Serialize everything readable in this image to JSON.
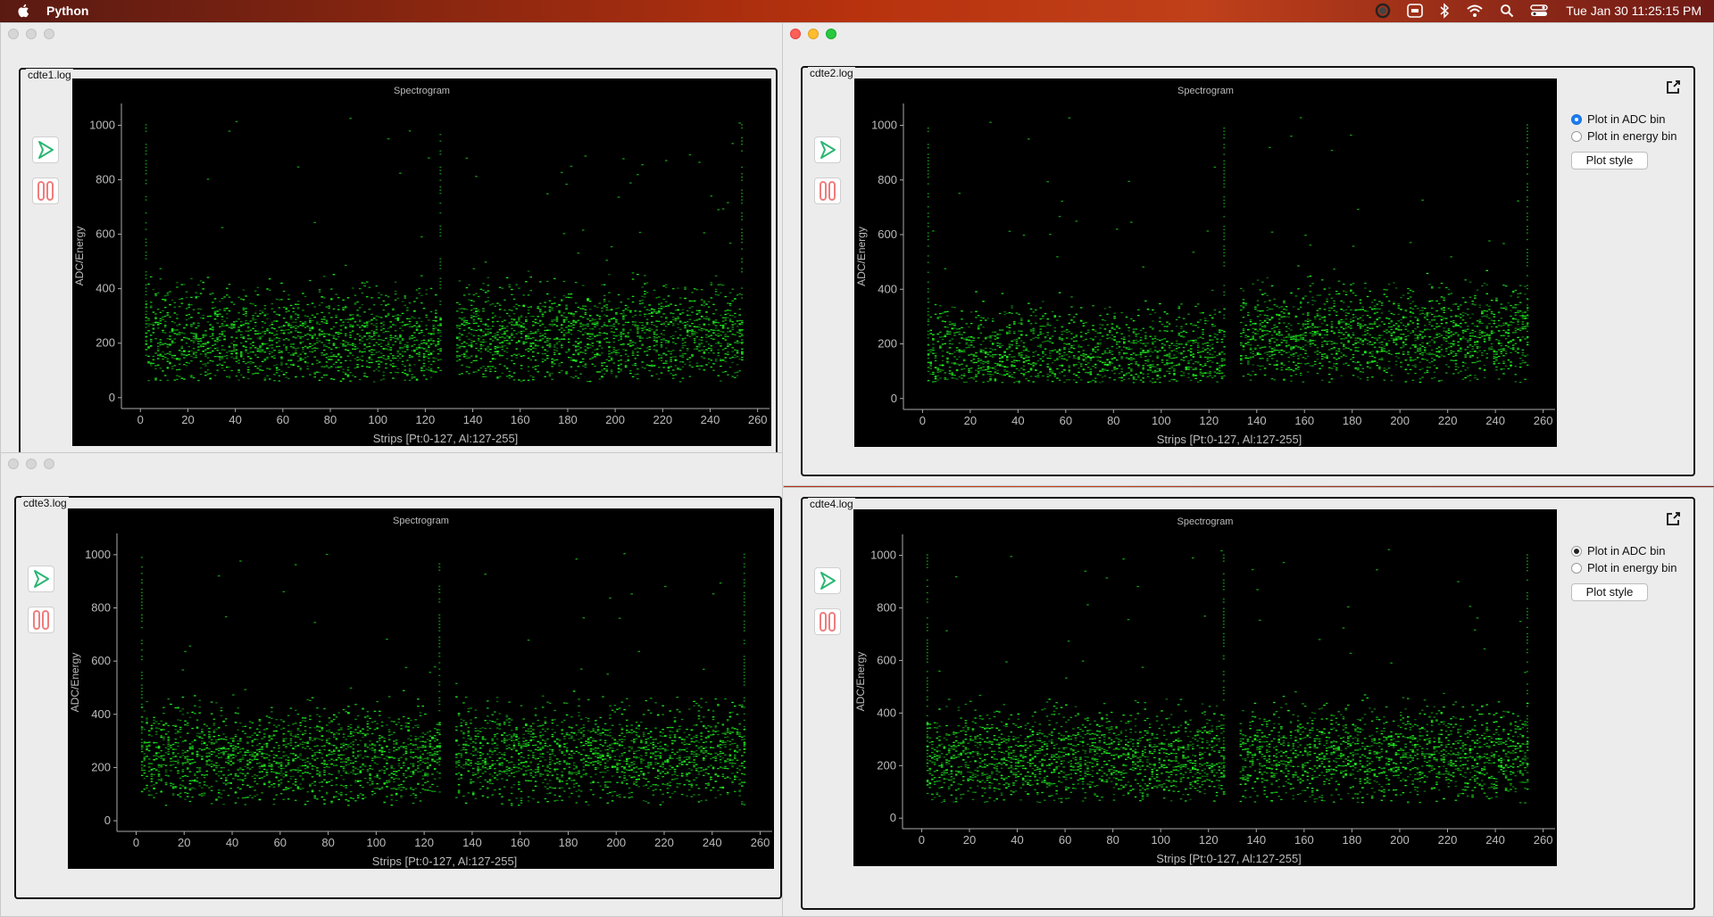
{
  "menubar": {
    "app_name": "Python",
    "clock": "Tue Jan 30  11:25:15 PM",
    "icons": [
      "apple-logo",
      "record-icon",
      "screen-share-icon",
      "bluetooth-icon",
      "wifi-icon",
      "search-icon",
      "control-center-icon"
    ]
  },
  "colors": {
    "accent": "#1a7cf5",
    "spectrum": "#22ff22",
    "plot_bg": "#000000",
    "play": "#2bb673",
    "pause": "#ef7d7d"
  },
  "windows": [
    {
      "group_label": "cdte1.log",
      "plot_title": "Spectrogram",
      "xlabel": "Strips [Pt:0-127, Al:127-255]",
      "ylabel": "ADC/Energy"
    },
    {
      "group_label": "cdte2.log",
      "plot_title": "Spectrogram",
      "xlabel": "Strips [Pt:0-127, Al:127-255]",
      "ylabel": "ADC/Energy",
      "options": {
        "adc_label": "Plot in ADC bin",
        "energy_label": "Plot in energy bin",
        "selected": "Plot in ADC bin",
        "style_button": "Plot style"
      }
    },
    {
      "group_label": "cdte3.log",
      "plot_title": "Spectrogram",
      "xlabel": "Strips [Pt:0-127, Al:127-255]",
      "ylabel": "ADC/Energy"
    },
    {
      "group_label": "cdte4.log",
      "plot_title": "Spectrogram",
      "xlabel": "Strips [Pt:0-127, Al:127-255]",
      "ylabel": "ADC/Energy",
      "options": {
        "adc_label": "Plot in ADC bin",
        "energy_label": "Plot in energy bin",
        "selected": "Plot in ADC bin",
        "style_button": "Plot style"
      }
    }
  ],
  "chart_data": [
    {
      "type": "heatmap",
      "title": "Spectrogram",
      "xlabel": "Strips [Pt:0-127, Al:127-255]",
      "ylabel": "ADC/Energy",
      "xticks": [
        0,
        20,
        40,
        60,
        80,
        100,
        120,
        140,
        160,
        180,
        200,
        220,
        240,
        260
      ],
      "yticks": [
        0,
        200,
        400,
        600,
        800,
        1000
      ],
      "xlim": [
        -8,
        265
      ],
      "ylim": [
        -40,
        1080
      ],
      "band_center": [
        210,
        230
      ],
      "gap_x": [
        127,
        132
      ]
    },
    {
      "type": "heatmap",
      "title": "Spectrogram",
      "xlabel": "Strips [Pt:0-127, Al:127-255]",
      "ylabel": "ADC/Energy",
      "xticks": [
        0,
        20,
        40,
        60,
        80,
        100,
        120,
        140,
        160,
        180,
        200,
        220,
        240,
        260
      ],
      "yticks": [
        0,
        200,
        400,
        600,
        800,
        1000
      ],
      "xlim": [
        -8,
        265
      ],
      "ylim": [
        -40,
        1080
      ],
      "band_center": [
        150,
        230
      ],
      "gap_x": [
        127,
        132
      ]
    },
    {
      "type": "heatmap",
      "title": "Spectrogram",
      "xlabel": "Strips [Pt:0-127, Al:127-255]",
      "ylabel": "ADC/Energy",
      "xticks": [
        0,
        20,
        40,
        60,
        80,
        100,
        120,
        140,
        160,
        180,
        200,
        220,
        240,
        260
      ],
      "yticks": [
        0,
        200,
        400,
        600,
        800,
        1000
      ],
      "xlim": [
        -8,
        265
      ],
      "ylim": [
        -40,
        1080
      ],
      "band_center": [
        240,
        250
      ],
      "gap_x": [
        127,
        132
      ]
    },
    {
      "type": "heatmap",
      "title": "Spectrogram",
      "xlabel": "Strips [Pt:0-127, Al:127-255]",
      "ylabel": "ADC/Energy",
      "xticks": [
        0,
        20,
        40,
        60,
        80,
        100,
        120,
        140,
        160,
        180,
        200,
        220,
        240,
        260
      ],
      "yticks": [
        0,
        200,
        400,
        600,
        800,
        1000
      ],
      "xlim": [
        -8,
        265
      ],
      "ylim": [
        -40,
        1080
      ],
      "band_center": [
        230,
        240
      ],
      "gap_x": [
        127,
        132
      ]
    }
  ]
}
